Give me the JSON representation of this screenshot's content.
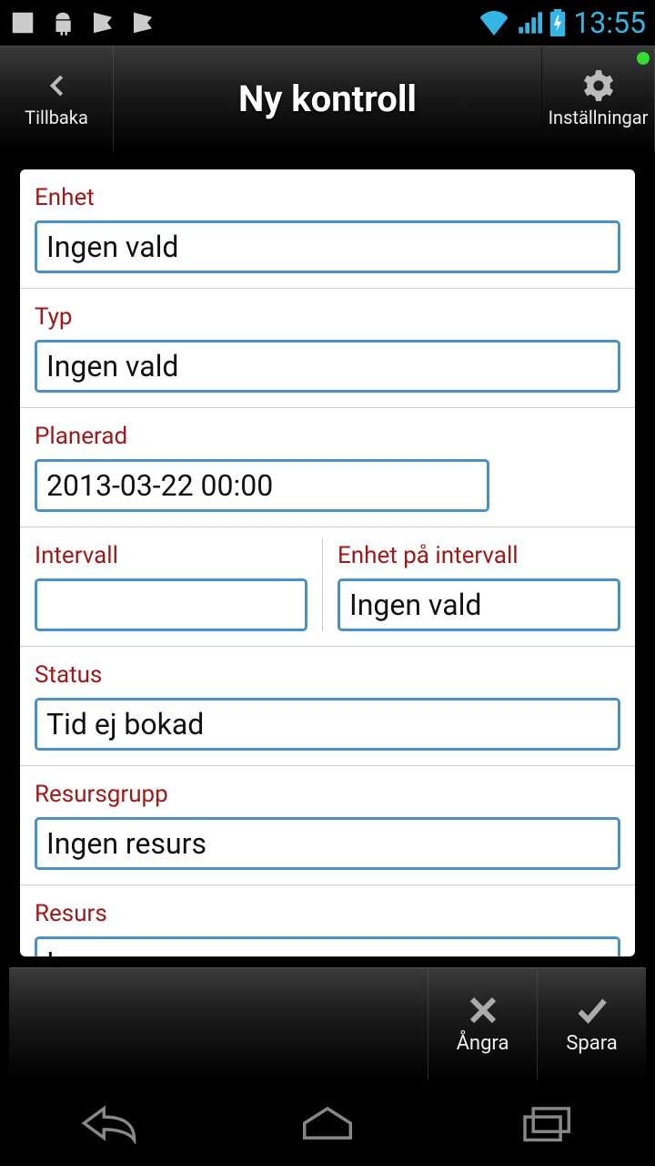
{
  "status": {
    "time": "13:55"
  },
  "header": {
    "back_label": "Tillbaka",
    "title": "Ny kontroll",
    "settings_label": "Inställningar"
  },
  "form": {
    "enhet": {
      "label": "Enhet",
      "value": "Ingen vald"
    },
    "typ": {
      "label": "Typ",
      "value": "Ingen vald"
    },
    "planerad": {
      "label": "Planerad",
      "value": "2013-03-22 00:00"
    },
    "intervall": {
      "label": "Intervall",
      "value": ""
    },
    "enhet_intervall": {
      "label": "Enhet på intervall",
      "value": "Ingen vald"
    },
    "status": {
      "label": "Status",
      "value": "Tid ej bokad"
    },
    "resursgrupp": {
      "label": "Resursgrupp",
      "value": "Ingen resurs"
    },
    "resurs": {
      "label": "Resurs",
      "value": "Ingen resurs"
    }
  },
  "toolbar": {
    "cancel_label": "Ångra",
    "save_label": "Spara"
  }
}
